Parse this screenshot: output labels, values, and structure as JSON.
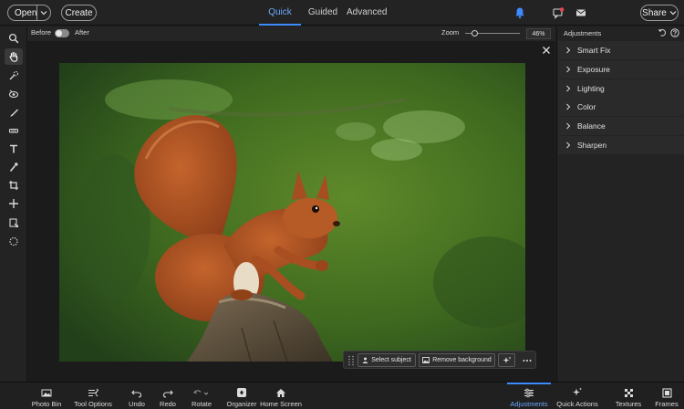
{
  "topbar": {
    "open_label": "Open",
    "create_label": "Create",
    "modes": [
      "Quick",
      "Guided",
      "Advanced"
    ],
    "active_mode": "Quick",
    "share_label": "Share"
  },
  "subbar": {
    "before_label": "Before",
    "after_label": "After",
    "zoom_label": "Zoom",
    "zoom_value": "46%"
  },
  "left_tools": [
    "zoom-icon",
    "hand-icon",
    "quick-selection-icon",
    "red-eye-icon",
    "healing-brush-icon",
    "whiten-teeth-icon",
    "type-icon",
    "spot-brush-icon",
    "crop-icon",
    "move-icon",
    "content-aware-icon",
    "lasso-icon"
  ],
  "panel": {
    "title": "Adjustments",
    "items": [
      "Smart Fix",
      "Exposure",
      "Lighting",
      "Color",
      "Balance",
      "Sharpen"
    ]
  },
  "floating_toolbar": {
    "select_subject": "Select subject",
    "remove_background": "Remove background"
  },
  "bottom_left": [
    "Photo Bin",
    "Tool Options",
    "Undo",
    "Redo",
    "Rotate",
    "Organizer",
    "Home Screen"
  ],
  "bottom_right": [
    "Adjustments",
    "Quick Actions",
    "Textures",
    "Frames"
  ],
  "active_bottom": "Adjustments",
  "colors": {
    "accent": "#3d8bff",
    "background": "#1e1e1e",
    "panel": "#232323"
  }
}
